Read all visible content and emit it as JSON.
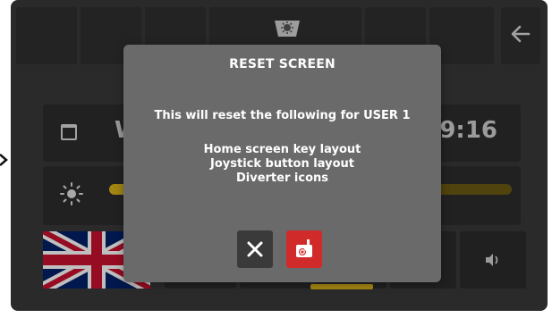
{
  "dialog": {
    "title": "RESET SCREEN",
    "message": "This will reset the following for USER 1",
    "items": [
      "Home screen key layout",
      "Joystick button layout",
      "Diverter icons"
    ],
    "cancel_icon": "close-icon",
    "confirm_icon": "reset-device-icon"
  },
  "background": {
    "date_partial": "W",
    "time_partial": "9:16",
    "top_center_icon": "fan-gear-icon",
    "back_icon": "arrow-left-icon",
    "calendar_icon": "calendar-icon",
    "brightness_icon": "sun-icon",
    "flag_icon": "uk-flag-icon",
    "speaker_icon": "speaker-icon"
  },
  "colors": {
    "accent_yellow": "#d9b21a",
    "confirm_red": "#d12a2a",
    "dialog_bg": "#6a6a6a",
    "screen_bg": "#383838"
  }
}
